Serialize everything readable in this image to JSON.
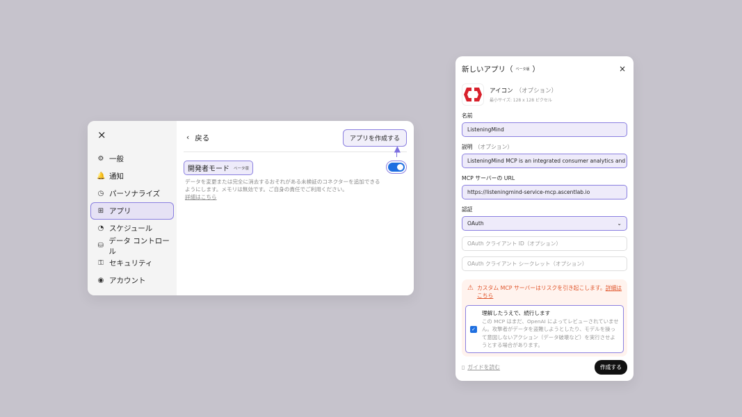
{
  "settings": {
    "close_icon": "×",
    "nav": [
      {
        "icon": "⚙",
        "label": "一般"
      },
      {
        "icon": "🔔",
        "label": "通知"
      },
      {
        "icon": "◷",
        "label": "パーソナライズ"
      },
      {
        "icon": "⊞",
        "label": "アプリ"
      },
      {
        "icon": "◔",
        "label": "スケジュール"
      },
      {
        "icon": "⛁",
        "label": "データ コントロール"
      },
      {
        "icon": "⚿",
        "label": "セキュリティ"
      },
      {
        "icon": "◉",
        "label": "アカウント"
      }
    ],
    "active_nav": "アプリ",
    "back_label": "戻る",
    "create_app_label": "アプリを作成する",
    "dev_mode": {
      "title": "開発者モード",
      "beta": "ベータ版",
      "enabled": true,
      "description": "データを変更または完全に消去するおそれがある未検証のコネクターを追加できるようにします。メモリは無効です。ご自身の責任でご利用ください。",
      "link": "詳細はこちら"
    }
  },
  "modal": {
    "title": "新しいアプリ（",
    "title_close": "）",
    "beta": "ベータ版",
    "close_icon": "×",
    "icon_label": "アイコン",
    "icon_optional": "（オプション）",
    "icon_hint": "最小サイズ: 128 x 128 ピクセル",
    "name_label": "名前",
    "name_value": "ListeningMind",
    "desc_label": "説明",
    "desc_optional": "（オプション）",
    "desc_value": "ListeningMind MCP is an integrated consumer analytics and",
    "url_label": "MCP サーバーの URL",
    "url_value": "https://listeningmind-service-mcp.ascentlab.io",
    "auth_label": "認証",
    "auth_value": "OAuth",
    "client_id_placeholder": "OAuth クライアント ID（オプション）",
    "client_secret_placeholder": "OAuth クライアント シークレット（オプション）",
    "warning_text": "カスタム MCP サーバーはリスクを引き起こします。",
    "warning_link": "詳細はこちら",
    "ack_title": "理解したうえで、続行します",
    "ack_body": "この MCP はまだ、OpenAI によってレビューされていません。攻撃者がデータを盗難しようとしたり、モデルを操って意図しないアクション（データ破壊など）を実行させようとする場合があります。",
    "ack_checked": true,
    "guide_link": "ガイドを読む",
    "create_button": "作成する"
  },
  "colors": {
    "accent_outline": "#8a7fe0",
    "toggle_blue": "#1f6fe0",
    "warning": "#e0552b",
    "logo_red": "#d8202b"
  }
}
